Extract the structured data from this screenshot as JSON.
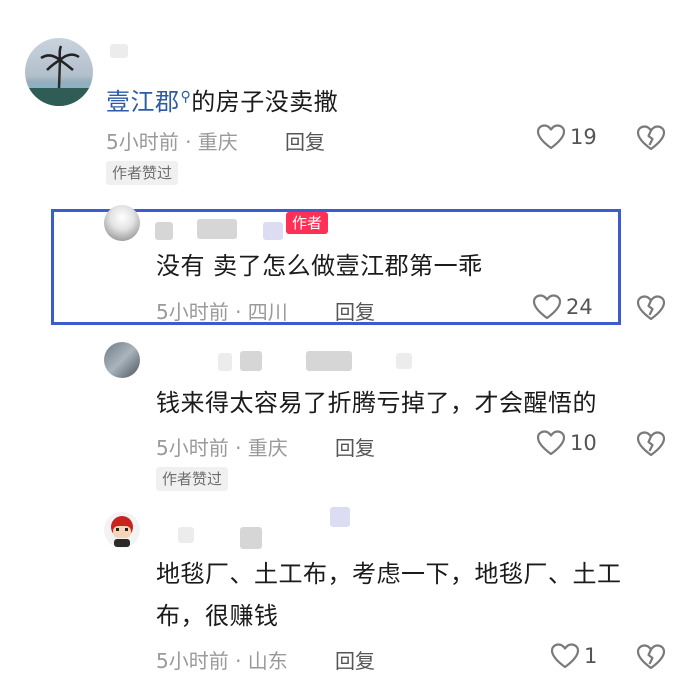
{
  "comments": [
    {
      "text_link": "壹江郡",
      "text": "的房子没卖撒",
      "time": "5小时前",
      "location": "· 重庆",
      "reply_label": "回复",
      "likes": "19",
      "author_liked_label": "作者赞过"
    },
    {
      "author_badge": "作者",
      "text": "没有 卖了怎么做壹江郡第一乖",
      "time": "5小时前",
      "location": "· 四川",
      "reply_label": "回复",
      "likes": "24"
    },
    {
      "text": "钱来得太容易了折腾亏掉了，才会醒悟的",
      "time": "5小时前",
      "location": "· 重庆",
      "reply_label": "回复",
      "likes": "10",
      "author_liked_label": "作者赞过"
    },
    {
      "text_line1": "地毯厂、土工布，考虑一下，地毯厂、土工",
      "text_line2": "布，很赚钱",
      "time": "5小时前",
      "location": "· 山东",
      "reply_label": "回复",
      "likes": "1"
    }
  ],
  "icons": {
    "like": "heart-outline-icon",
    "dislike": "broken-heart-icon",
    "search": "search-icon"
  },
  "colors": {
    "link": "#2e5aa8",
    "author_badge": "#ff2f55",
    "highlight": "#3a5ccf"
  }
}
